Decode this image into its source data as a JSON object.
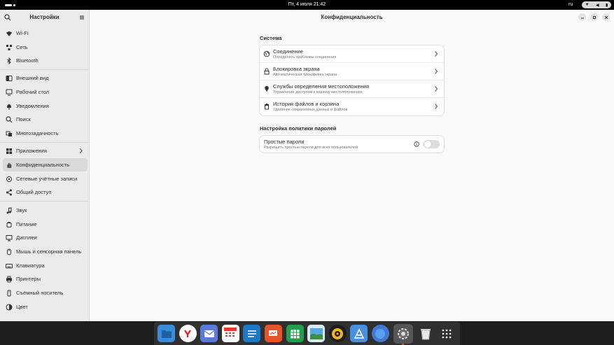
{
  "topbar": {
    "clock": "Пт, 4 июля  21:42",
    "lang": "ru"
  },
  "sidebar": {
    "title": "Настройки",
    "items": [
      {
        "label": "Wi-Fi",
        "icon": "wifi-icon"
      },
      {
        "label": "Сеть",
        "icon": "network-icon"
      },
      {
        "label": "Bluetooth",
        "icon": "bluetooth-icon"
      },
      {
        "label": "Внешний вид",
        "icon": "appearance-icon"
      },
      {
        "label": "Рабочий стол",
        "icon": "desktop-icon"
      },
      {
        "label": "Уведомления",
        "icon": "bell-icon"
      },
      {
        "label": "Поиск",
        "icon": "search-icon"
      },
      {
        "label": "Многозадачность",
        "icon": "multitasking-icon"
      },
      {
        "label": "Приложения",
        "icon": "apps-icon"
      },
      {
        "label": "Конфиденциальность",
        "icon": "hand-icon"
      },
      {
        "label": "Сетевые учётные записи",
        "icon": "online-accounts-icon"
      },
      {
        "label": "Общий доступ",
        "icon": "sharing-icon"
      },
      {
        "label": "Звук",
        "icon": "music-note-icon"
      },
      {
        "label": "Питание",
        "icon": "power-icon"
      },
      {
        "label": "Дисплеи",
        "icon": "display-icon"
      },
      {
        "label": "Мышь и сенсорная панель",
        "icon": "mouse-icon"
      },
      {
        "label": "Клавиатура",
        "icon": "keyboard-icon"
      },
      {
        "label": "Принтеры",
        "icon": "printer-icon"
      },
      {
        "label": "Съёмный носитель",
        "icon": "removable-media-icon"
      },
      {
        "label": "Цвет",
        "icon": "color-icon"
      }
    ]
  },
  "main": {
    "title": "Конфиденциальность",
    "system_section": "Система",
    "system_rows": [
      {
        "title": "Соединение",
        "subtitle": "Определять проблемы соединения",
        "icon": "globe-icon"
      },
      {
        "title": "Блокировка экрана",
        "subtitle": "Автоматическая блокировка экрана",
        "icon": "lock-icon"
      },
      {
        "title": "Службы определения местоположения",
        "subtitle": "Управление доступом к вашему местоположению",
        "icon": "location-pin-icon"
      },
      {
        "title": "История файлов и корзина",
        "subtitle": "Удаление сохраненных данных и файлов",
        "icon": "trash-icon"
      }
    ],
    "password_section": "Настройка политики паролей",
    "password_row": {
      "title": "Простые пароли",
      "subtitle": "Разрешить простые пароли для всех пользователей",
      "enabled": false
    }
  },
  "dock": [
    "files-icon",
    "yandex-browser-icon",
    "mail-icon",
    "calendar-icon",
    "writer-icon",
    "impress-icon",
    "calc-icon",
    "image-viewer-icon",
    "rhythmbox-icon",
    "app-center-icon",
    "web-browser-icon",
    "settings-icon",
    "trash-icon",
    "show-apps-icon"
  ]
}
